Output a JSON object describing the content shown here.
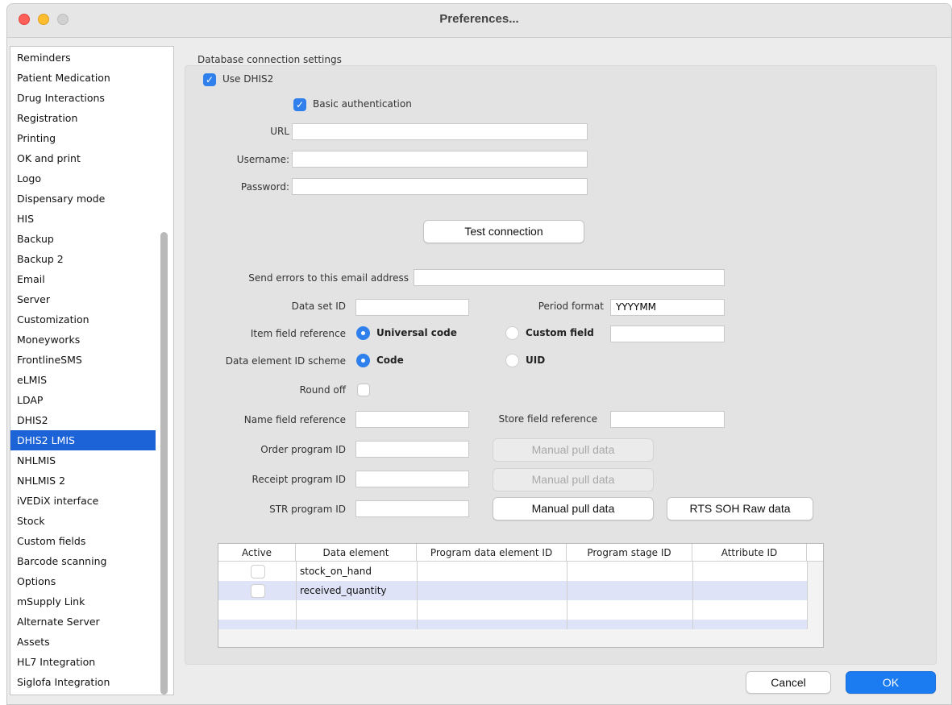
{
  "window": {
    "title": "Preferences..."
  },
  "sidebar": {
    "items": [
      {
        "label": "Reminders"
      },
      {
        "label": "Patient Medication"
      },
      {
        "label": "Drug Interactions"
      },
      {
        "label": "Registration"
      },
      {
        "label": "Printing"
      },
      {
        "label": "OK and print"
      },
      {
        "label": "Logo"
      },
      {
        "label": "Dispensary mode"
      },
      {
        "label": "HIS"
      },
      {
        "label": "Backup"
      },
      {
        "label": "Backup 2"
      },
      {
        "label": "Email"
      },
      {
        "label": "Server"
      },
      {
        "label": "Customization"
      },
      {
        "label": "Moneyworks"
      },
      {
        "label": "FrontlineSMS"
      },
      {
        "label": "eLMIS"
      },
      {
        "label": "LDAP"
      },
      {
        "label": "DHIS2"
      },
      {
        "label": "DHIS2 LMIS"
      },
      {
        "label": "NHLMIS"
      },
      {
        "label": "NHLMIS 2"
      },
      {
        "label": "iVEDiX interface"
      },
      {
        "label": "Stock"
      },
      {
        "label": "Custom fields"
      },
      {
        "label": "Barcode scanning"
      },
      {
        "label": "Options"
      },
      {
        "label": "mSupply Link"
      },
      {
        "label": "Alternate Server"
      },
      {
        "label": "Assets"
      },
      {
        "label": "HL7 Integration"
      },
      {
        "label": "Siglofa Integration"
      }
    ],
    "selected": "DHIS2 LMIS"
  },
  "main": {
    "section_label": "Database connection settings",
    "use_dhis2": {
      "label": "Use DHIS2",
      "checked": true
    },
    "basic_auth": {
      "label": "Basic authentication",
      "checked": true
    },
    "url": {
      "label": "URL",
      "value": ""
    },
    "username": {
      "label": "Username:",
      "value": ""
    },
    "password": {
      "label": "Password:",
      "value": ""
    },
    "test_connection_label": "Test connection",
    "error_email": {
      "label": "Send errors to this email address",
      "value": ""
    },
    "data_set_id": {
      "label": "Data set ID",
      "value": ""
    },
    "period_format": {
      "label": "Period format",
      "value": "YYYYMM"
    },
    "item_field_reference": {
      "label": "Item field reference",
      "options": [
        "Universal code",
        "Custom field"
      ],
      "selected": "Universal code",
      "custom_value": ""
    },
    "data_element_id_scheme": {
      "label": "Data element ID scheme",
      "options": [
        "Code",
        "UID"
      ],
      "selected": "Code"
    },
    "round_off": {
      "label": "Round off",
      "checked": false
    },
    "name_field_reference": {
      "label": "Name field reference",
      "value": ""
    },
    "store_field_reference": {
      "label": "Store field reference",
      "value": ""
    },
    "order_program_id": {
      "label": "Order program ID",
      "value": ""
    },
    "receipt_program_id": {
      "label": "Receipt program ID",
      "value": ""
    },
    "str_program_id": {
      "label": "STR program ID",
      "value": ""
    },
    "manual_pull_label": "Manual pull data",
    "rts_soh_label": "RTS SOH Raw data"
  },
  "table": {
    "columns": [
      "Active",
      "Data element",
      "Program data element ID",
      "Program stage ID",
      "Attribute ID"
    ],
    "rows": [
      {
        "active": false,
        "data_element": "stock_on_hand",
        "program_data_element_id": "",
        "program_stage_id": "",
        "attribute_id": ""
      },
      {
        "active": false,
        "data_element": "received_quantity",
        "program_data_element_id": "",
        "program_stage_id": "",
        "attribute_id": ""
      }
    ]
  },
  "footer": {
    "cancel_label": "Cancel",
    "ok_label": "OK"
  },
  "colors": {
    "accent": "#1a7cf0",
    "selection": "#1c63d8"
  }
}
